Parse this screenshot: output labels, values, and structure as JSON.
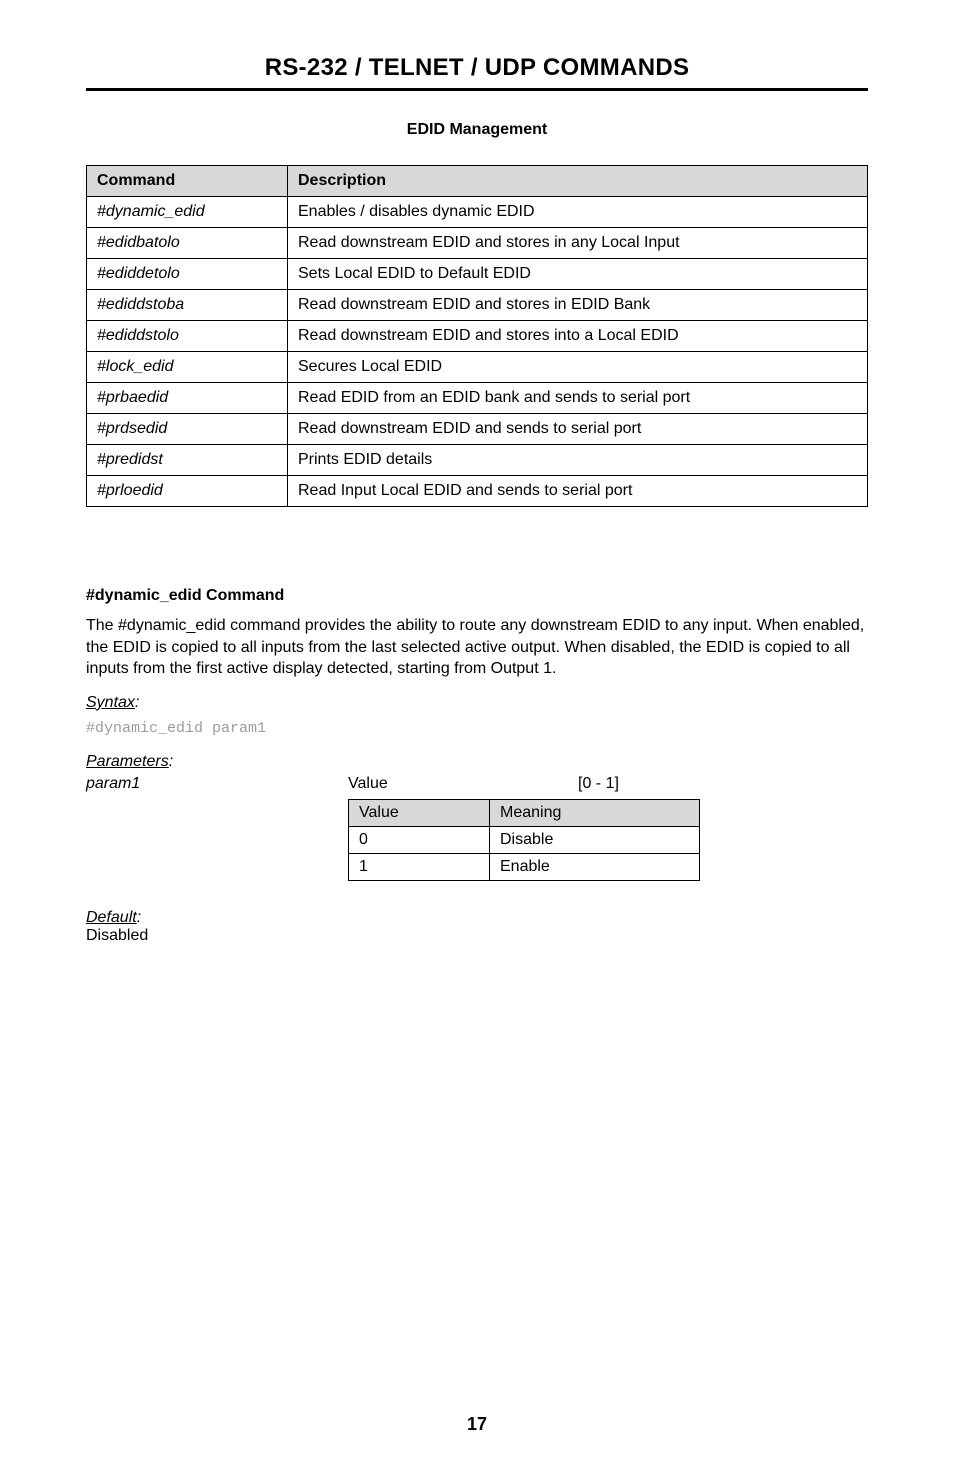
{
  "header": {
    "title": "RS-232 / TELNET / UDP COMMANDS"
  },
  "section_title": "EDID Management",
  "cmd_table": {
    "head": {
      "c1": "Command",
      "c2": "Description"
    },
    "rows": [
      {
        "cmd": "#dynamic_edid",
        "desc": "Enables / disables dynamic EDID"
      },
      {
        "cmd": "#edidbatolo",
        "desc": "Read downstream EDID and stores in any Local Input"
      },
      {
        "cmd": "#ediddetolo",
        "desc": "Sets Local EDID to Default EDID"
      },
      {
        "cmd": "#ediddstoba",
        "desc": "Read downstream EDID and stores in EDID Bank"
      },
      {
        "cmd": "#ediddstolo",
        "desc": "Read downstream EDID and stores into a Local EDID"
      },
      {
        "cmd": "#lock_edid",
        "desc": "Secures Local EDID"
      },
      {
        "cmd": "#prbaedid",
        "desc": "Read EDID from an EDID bank and sends to serial port"
      },
      {
        "cmd": "#prdsedid",
        "desc": "Read downstream EDID and sends to serial port"
      },
      {
        "cmd": "#predidst",
        "desc": "Prints EDID details"
      },
      {
        "cmd": "#prloedid",
        "desc": "Read Input Local EDID and sends to serial port"
      }
    ]
  },
  "command_detail": {
    "title": "#dynamic_edid Command",
    "description": "The #dynamic_edid command provides the ability to route any downstream EDID to any input.  When enabled, the EDID is copied to all inputs from the last selected active output.  When disabled, the EDID is copied to all inputs from the first active display detected, starting from Output 1.",
    "syntax_label": "Syntax",
    "syntax_colon": ":",
    "syntax_code": "#dynamic_edid param1",
    "parameters_label": "Parameters",
    "parameters_colon": ":",
    "param_row": {
      "name": "param1",
      "value_label": "Value",
      "range": "[0 - 1]"
    },
    "value_table": {
      "head": {
        "c1": "Value",
        "c2": "Meaning"
      },
      "rows": [
        {
          "v": "0",
          "m": "Disable"
        },
        {
          "v": "1",
          "m": "Enable"
        }
      ]
    },
    "default_label": "Default",
    "default_colon": ":",
    "default_value": "Disabled"
  },
  "page_number": "17"
}
